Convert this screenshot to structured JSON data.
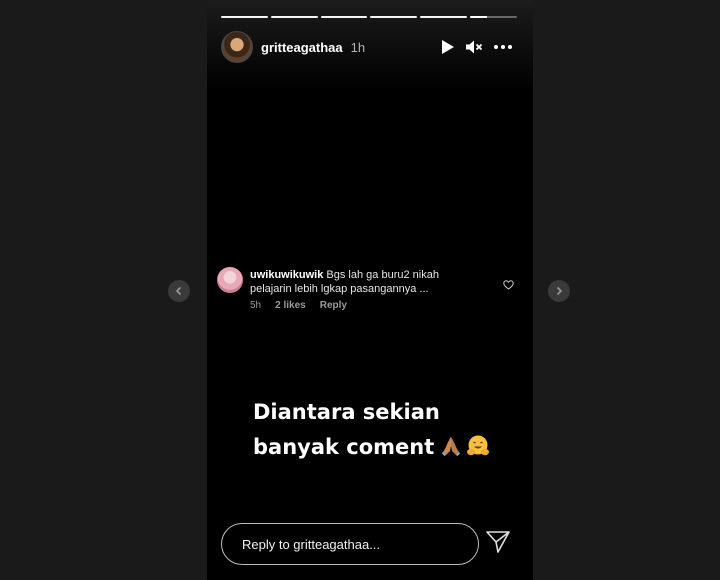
{
  "story": {
    "segments": 6,
    "current_segment_progress": 0.35
  },
  "header": {
    "username": "gritteagathaa",
    "time": "1h",
    "icons": [
      "play-icon",
      "mute-icon",
      "more-icon"
    ]
  },
  "comment": {
    "username": "uwikuwikuwik",
    "text": "Bgs lah ga buru2 nikah pelajarin lebih lgkap pasangannya ...",
    "age": "5h",
    "likes": "2 likes",
    "reply_label": "Reply"
  },
  "caption": {
    "line1": "Diantara sekian",
    "line2": "banyak coment"
  },
  "footer": {
    "reply_placeholder": "Reply to gritteagathaa..."
  },
  "colors": {
    "background": "#1a1a1a",
    "story_bg": "#000000",
    "muted_text": "#9a9a9a"
  }
}
